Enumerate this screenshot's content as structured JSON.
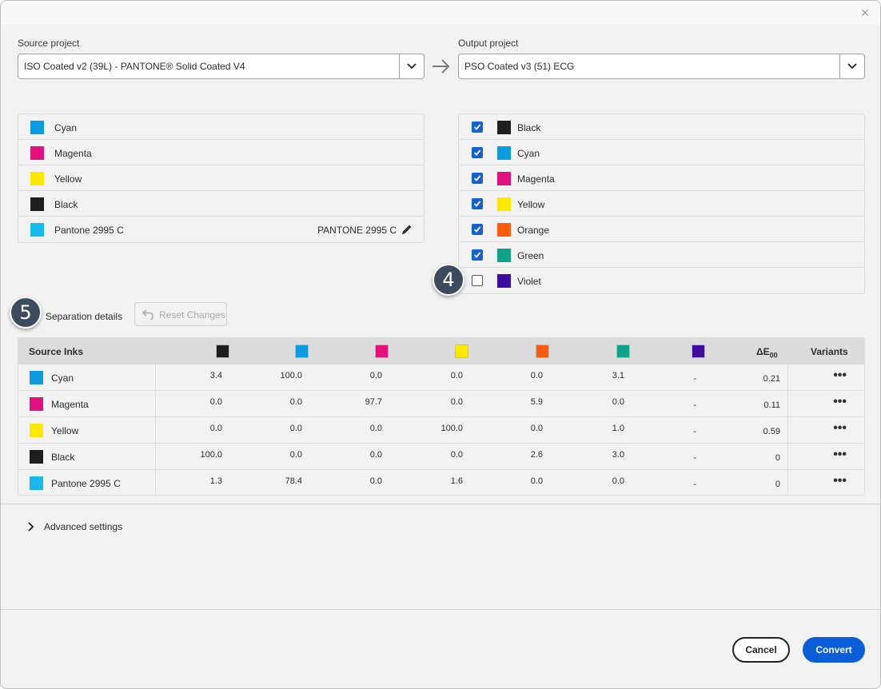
{
  "source": {
    "label": "Source project",
    "value": "ISO Coated v2 (39L) - PANTONE® Solid Coated V4",
    "inks": [
      {
        "name": "Cyan",
        "color": "#0d9be0"
      },
      {
        "name": "Magenta",
        "color": "#e0107f"
      },
      {
        "name": "Yellow",
        "color": "#ffe800"
      },
      {
        "name": "Black",
        "color": "#1e1e1e"
      },
      {
        "name": "Pantone 2995 C",
        "color": "#19b8ee",
        "mapped_to": "PANTONE 2995 C"
      }
    ]
  },
  "output": {
    "label": "Output project",
    "value": "PSO Coated v3 (51) ECG",
    "inks": [
      {
        "name": "Black",
        "color": "#1e1e1e",
        "checked": true
      },
      {
        "name": "Cyan",
        "color": "#0d9be0",
        "checked": true
      },
      {
        "name": "Magenta",
        "color": "#e0107f",
        "checked": true
      },
      {
        "name": "Yellow",
        "color": "#ffe800",
        "checked": true
      },
      {
        "name": "Orange",
        "color": "#ff5b0f",
        "checked": true
      },
      {
        "name": "Green",
        "color": "#0fa389",
        "checked": true
      },
      {
        "name": "Violet",
        "color": "#3c0da0",
        "checked": false
      }
    ]
  },
  "badges": {
    "four": "4",
    "five": "5"
  },
  "separation": {
    "label": "Separation details",
    "reset_label": "Reset Changes",
    "head_source": "Source Inks",
    "head_delta": "ΔE",
    "head_delta_sub": "00",
    "head_variants": "Variants",
    "column_colors": [
      "#1e1e1e",
      "#0d9be0",
      "#e0107f",
      "#ffe800",
      "#ff5b0f",
      "#0fa389",
      "#3c0da0"
    ],
    "rows": [
      {
        "name": "Cyan",
        "color": "#0d9be0",
        "values": [
          "3.4",
          "100.0",
          "0.0",
          "0.0",
          "0.0",
          "3.1",
          "-"
        ],
        "delta": "0.21",
        "more": "•••"
      },
      {
        "name": "Magenta",
        "color": "#e0107f",
        "values": [
          "0.0",
          "0.0",
          "97.7",
          "0.0",
          "5.9",
          "0.0",
          "-"
        ],
        "delta": "0.11",
        "more": "•••"
      },
      {
        "name": "Yellow",
        "color": "#ffe800",
        "values": [
          "0.0",
          "0.0",
          "0.0",
          "100.0",
          "0.0",
          "1.0",
          "-"
        ],
        "delta": "0.59",
        "more": "•••"
      },
      {
        "name": "Black",
        "color": "#1e1e1e",
        "values": [
          "100.0",
          "0.0",
          "0.0",
          "0.0",
          "2.6",
          "3.0",
          "-"
        ],
        "delta": "0",
        "more": "•••"
      },
      {
        "name": "Pantone 2995 C",
        "color": "#19b8ee",
        "values": [
          "1.3",
          "78.4",
          "0.0",
          "1.6",
          "0.0",
          "0.0",
          "-"
        ],
        "delta": "0",
        "more": "•••"
      }
    ]
  },
  "advanced": {
    "label": "Advanced settings"
  },
  "footer": {
    "cancel": "Cancel",
    "convert": "Convert"
  },
  "icons": {
    "close": "close-icon",
    "arrow": "arrow-right-icon",
    "caret": "chevron-down-icon",
    "pencil": "pencil-icon",
    "undo": "undo-icon",
    "expand": "chevron-right-icon"
  }
}
